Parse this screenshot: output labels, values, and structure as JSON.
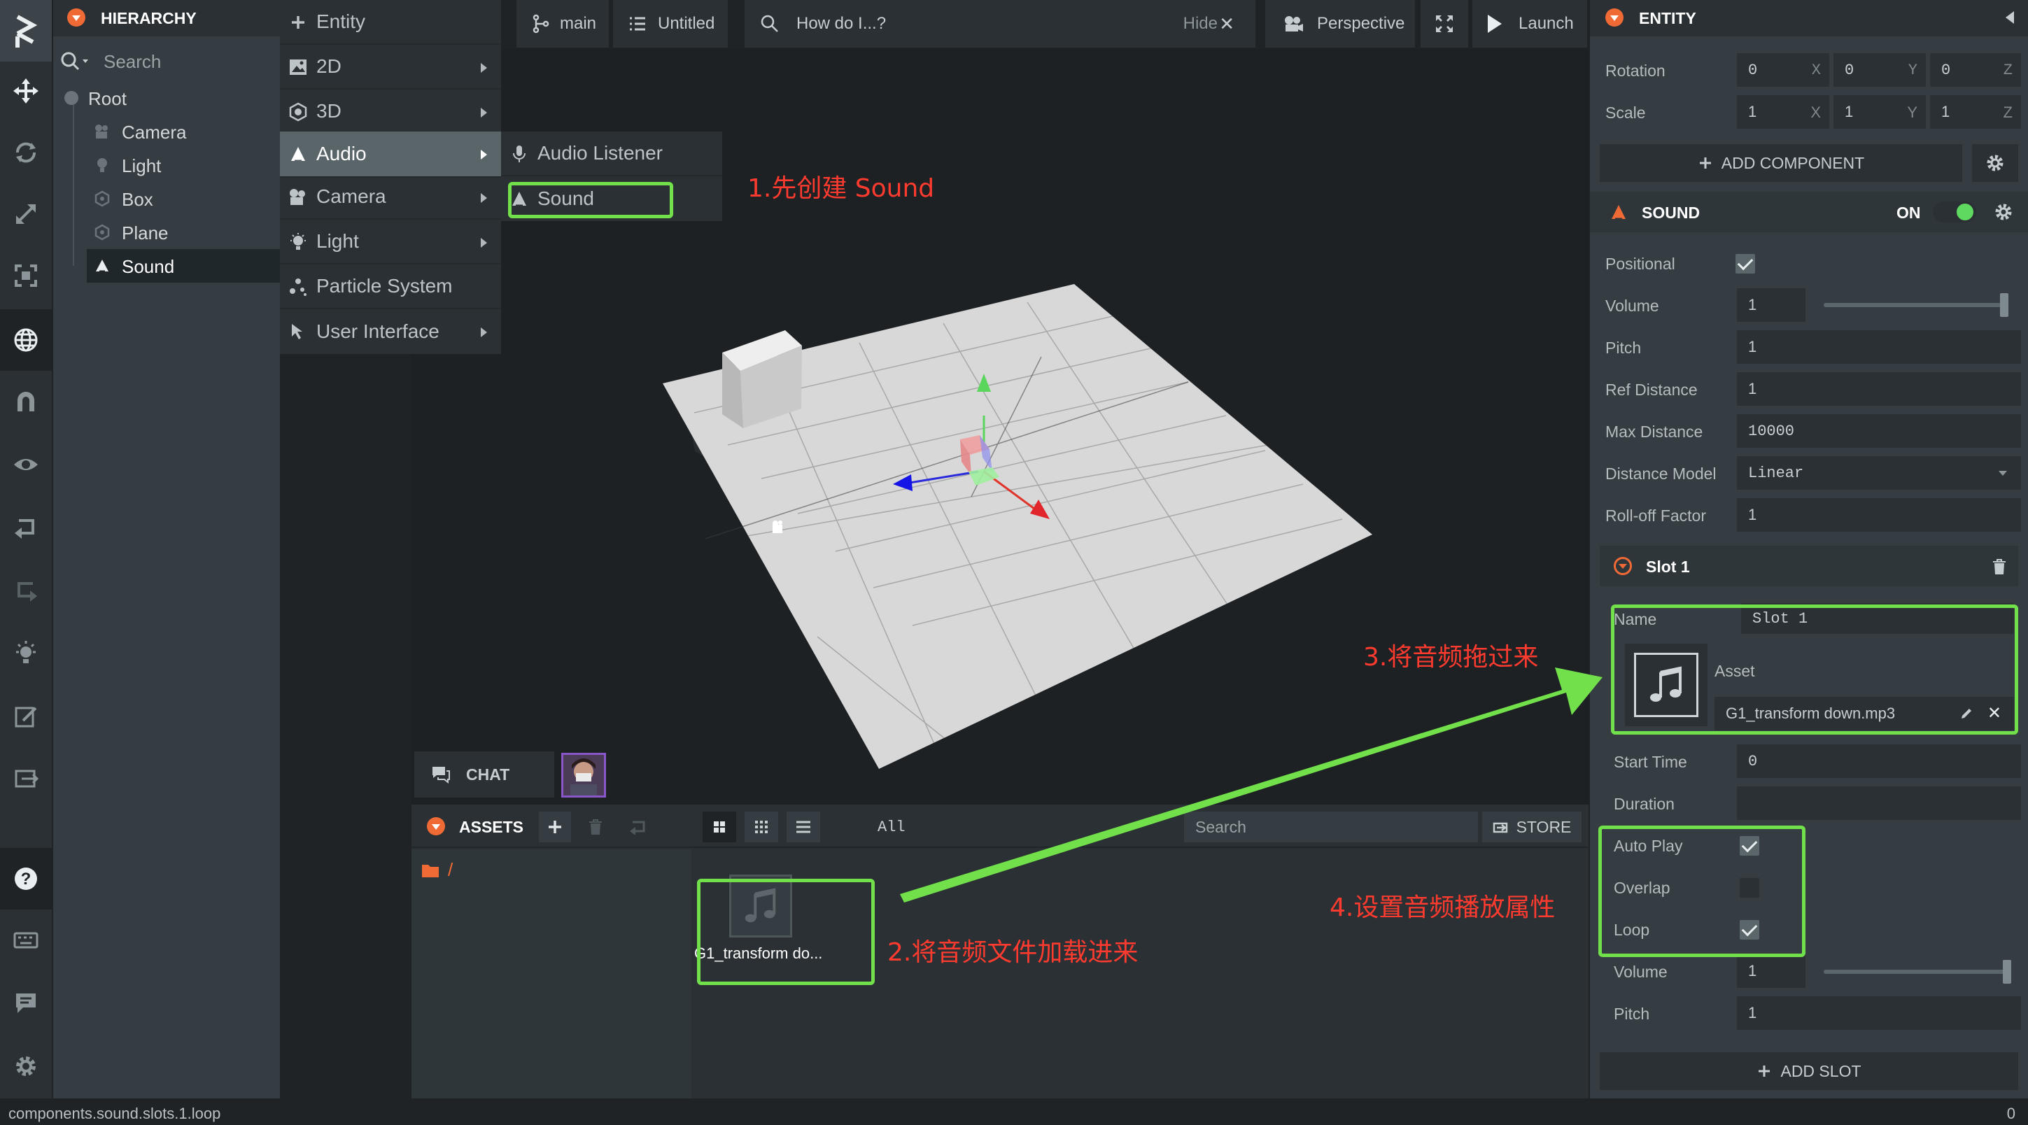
{
  "colors": {
    "accent": "#f06a35",
    "annotation": "#ff3b2f",
    "highlight": "#72e04a",
    "toggle_on": "#5fd95f"
  },
  "hierarchy": {
    "title": "HIERARCHY",
    "search_placeholder": "Search",
    "items": [
      {
        "label": "Root",
        "icon": "entity-dot-icon"
      },
      {
        "label": "Camera",
        "icon": "camera-icon"
      },
      {
        "label": "Light",
        "icon": "light-icon"
      },
      {
        "label": "Box",
        "icon": "box-icon"
      },
      {
        "label": "Plane",
        "icon": "plane-icon"
      },
      {
        "label": "Sound",
        "icon": "sound-icon",
        "selected": true
      }
    ]
  },
  "context_menu": {
    "items": [
      "Entity",
      "2D",
      "3D",
      "Audio",
      "Camera",
      "Light",
      "Particle System",
      "User Interface"
    ],
    "active": "Audio",
    "submenu": [
      "Audio Listener",
      "Sound"
    ]
  },
  "topbar": {
    "branch": "main",
    "scene": "Untitled",
    "help_search": "How do I...?",
    "hide": "Hide",
    "camera": "Perspective",
    "launch": "Launch"
  },
  "viewport": {
    "chat": "CHAT"
  },
  "assets": {
    "title": "ASSETS",
    "folder": "/",
    "filter": "All",
    "search_placeholder": "Search",
    "store": "STORE",
    "file": "G1_transform do..."
  },
  "inspector": {
    "title": "ENTITY",
    "rotation": {
      "label": "Rotation",
      "x": "0",
      "y": "0",
      "z": "0"
    },
    "scale": {
      "label": "Scale",
      "x": "1",
      "y": "1",
      "z": "1"
    },
    "axes": [
      "X",
      "Y",
      "Z"
    ],
    "add_component": "ADD COMPONENT",
    "sound": {
      "title": "SOUND",
      "state": "ON",
      "positional_label": "Positional",
      "positional": true,
      "volume_label": "Volume",
      "volume": "1",
      "volume_level": 1,
      "pitch_label": "Pitch",
      "pitch": "1",
      "ref_distance_label": "Ref Distance",
      "ref_distance": "1",
      "max_distance_label": "Max Distance",
      "max_distance": "10000",
      "distance_model_label": "Distance Model",
      "distance_model": "Linear",
      "rolloff_label": "Roll-off Factor",
      "rolloff": "1"
    },
    "slot": {
      "title": "Slot 1",
      "name_label": "Name",
      "name": "Slot 1",
      "asset_label": "Asset",
      "asset": "G1_transform down.mp3",
      "start_time_label": "Start Time",
      "start_time": "0",
      "duration_label": "Duration",
      "duration": "",
      "autoplay_label": "Auto Play",
      "autoplay": true,
      "overlap_label": "Overlap",
      "overlap": false,
      "loop_label": "Loop",
      "loop": true,
      "volume_label": "Volume",
      "volume": "1",
      "volume_level": 1,
      "pitch_label": "Pitch",
      "pitch": "1"
    },
    "add_slot": "ADD SLOT"
  },
  "status": {
    "path": "components.sound.slots.1.loop",
    "count": "0"
  },
  "annotations": {
    "step1": "1.先创建 Sound",
    "step2": "2.将音频文件加载进来",
    "step3": "3.将音频拖过来",
    "step4": "4.设置音频播放属性"
  }
}
